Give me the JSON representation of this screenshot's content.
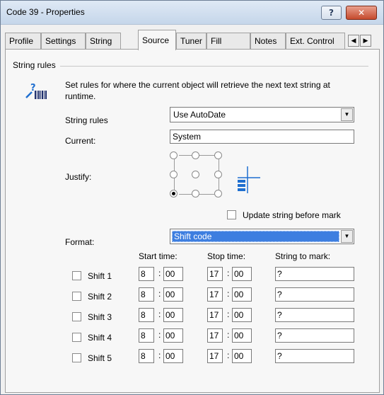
{
  "window": {
    "title": "Code 39 - Properties",
    "help_label": "?",
    "close_label": "✕"
  },
  "tabs": [
    {
      "label": "Profile",
      "active": false
    },
    {
      "label": "Settings",
      "active": false
    },
    {
      "label": "String",
      "active": false
    },
    {
      "label": "Source",
      "active": true
    },
    {
      "label": "Tuner",
      "active": false
    },
    {
      "label": "Fill",
      "active": false
    },
    {
      "label": "Notes",
      "active": false
    },
    {
      "label": "Ext. Control",
      "active": false
    }
  ],
  "tab_scroll": {
    "left": "◀",
    "right": "▶"
  },
  "group": {
    "label": "String rules",
    "icon": "barcode-query-icon",
    "info": "Set rules for where the current object will retrieve the next text string at runtime."
  },
  "string_rules": {
    "label": "String rules",
    "value": "Use AutoDate"
  },
  "current": {
    "label": "Current:",
    "value": "System"
  },
  "justify": {
    "label": "Justify:",
    "selected": "bottom-left"
  },
  "update_string": {
    "label": "Update string before mark",
    "checked": false
  },
  "format": {
    "label": "Format:",
    "value": "Shift code"
  },
  "columns": {
    "start": "Start time:",
    "stop": "Stop time:",
    "mark": "String to mark:"
  },
  "colon": ":",
  "shifts": [
    {
      "label": "Shift 1",
      "checked": false,
      "start_h": "8",
      "start_m": "00",
      "stop_h": "17",
      "stop_m": "00",
      "mark": "?"
    },
    {
      "label": "Shift 2",
      "checked": false,
      "start_h": "8",
      "start_m": "00",
      "stop_h": "17",
      "stop_m": "00",
      "mark": "?"
    },
    {
      "label": "Shift 3",
      "checked": false,
      "start_h": "8",
      "start_m": "00",
      "stop_h": "17",
      "stop_m": "00",
      "mark": "?"
    },
    {
      "label": "Shift 4",
      "checked": false,
      "start_h": "8",
      "start_m": "00",
      "stop_h": "17",
      "stop_m": "00",
      "mark": "?"
    },
    {
      "label": "Shift 5",
      "checked": false,
      "start_h": "8",
      "start_m": "00",
      "stop_h": "17",
      "stop_m": "00",
      "mark": "?"
    }
  ],
  "colors": {
    "selection": "#3d7ee0",
    "close_button": "#c54a2d",
    "titlebar": "#c5d6ea"
  }
}
